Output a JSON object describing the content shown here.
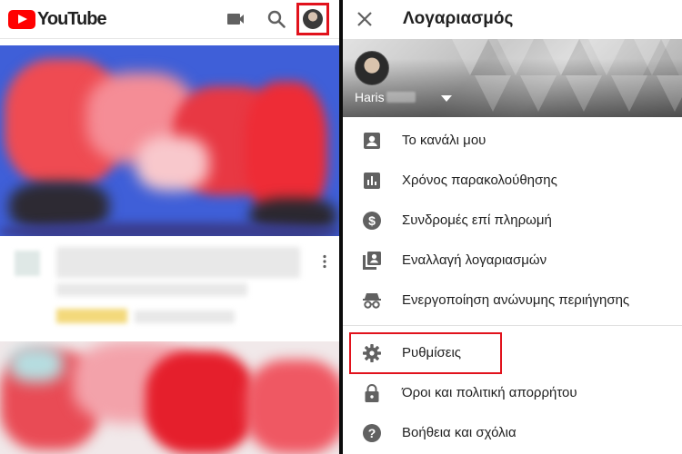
{
  "left_panel": {
    "app_name": "YouTube",
    "header_icons": [
      "camera-icon",
      "search-icon",
      "account-avatar"
    ]
  },
  "right_panel": {
    "title": "Λογαριασμός",
    "user": {
      "name": "Haris"
    },
    "menu_top": [
      {
        "label": "Το κανάλι μου",
        "icon": "person-box-icon"
      },
      {
        "label": "Χρόνος παρακολούθησης",
        "icon": "bar-chart-icon"
      },
      {
        "label": "Συνδρομές επί πληρωμή",
        "icon": "dollar-icon"
      },
      {
        "label": "Εναλλαγή λογαριασμών",
        "icon": "switch-account-icon"
      },
      {
        "label": "Ενεργοποίηση ανώνυμης περιήγησης",
        "icon": "incognito-icon"
      }
    ],
    "menu_bottom": [
      {
        "label": "Ρυθμίσεις",
        "icon": "gear-icon"
      },
      {
        "label": "Όροι και πολιτική απορρήτου",
        "icon": "lock-icon"
      },
      {
        "label": "Βοήθεια και σχόλια",
        "icon": "help-icon"
      }
    ]
  },
  "colors": {
    "youtube_red": "#ff0000",
    "highlight_red": "#e1121c",
    "icon_grey": "#616161"
  }
}
